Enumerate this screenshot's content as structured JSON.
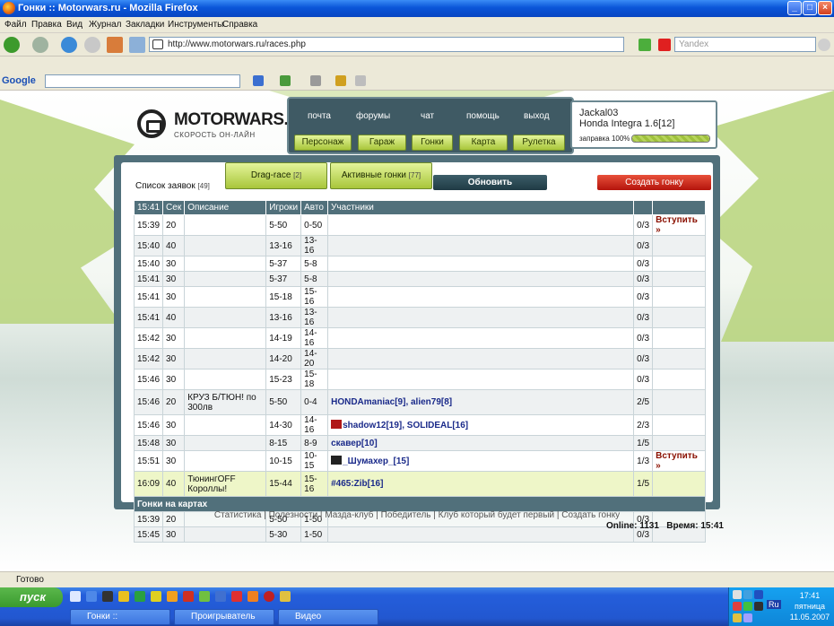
{
  "window": {
    "title": "Гонки :: Motorwars.ru - Mozilla Firefox",
    "min": "_",
    "max": "□",
    "close": "×"
  },
  "menu": [
    "Файл",
    "Правка",
    "Вид",
    "Журнал",
    "Закладки",
    "Инструменты",
    "Справка"
  ],
  "nav": {
    "url": "http://www.motorwars.ru/races.php",
    "search_placeholder": "Yandex"
  },
  "google": {
    "label": "Google"
  },
  "site": {
    "logo": "MOTORWARS.RU",
    "tagline": "СКОРОСТЬ ОН-ЛАЙН",
    "top_links": [
      "почта",
      "форумы",
      "чат",
      "помощь",
      "выход"
    ],
    "buttons": [
      "Персонаж",
      "Гараж",
      "Гонки",
      "Карта",
      "Рулетка"
    ],
    "user": {
      "name": "Jackal03",
      "car": "Honda Integra 1.6[12]",
      "fuel_label": "заправка 100%",
      "fuel_percent": 100
    }
  },
  "races": {
    "list_title": "Список заявок",
    "list_count": "[49]",
    "tab_drag": "Drag-race",
    "tab_drag_count": "[2]",
    "tab_active": "Активные гонки",
    "tab_active_count": "[77]",
    "refresh": "Обновить",
    "create": "Создать гонку",
    "headers": [
      "15:41",
      "Сек",
      "Описание",
      "Игроки",
      "Авто",
      "Участники",
      "",
      ""
    ],
    "rows": [
      {
        "time": "15:39",
        "sec": "20",
        "desc": "",
        "players": "5-50",
        "auto": "0-50",
        "parts": "",
        "count": "0/3",
        "join": "Вступить »"
      },
      {
        "time": "15:40",
        "sec": "40",
        "desc": "",
        "players": "13-16",
        "auto": "13-16",
        "parts": "",
        "count": "0/3",
        "join": ""
      },
      {
        "time": "15:40",
        "sec": "30",
        "desc": "",
        "players": "5-37",
        "auto": "5-8",
        "parts": "",
        "count": "0/3",
        "join": ""
      },
      {
        "time": "15:41",
        "sec": "30",
        "desc": "",
        "players": "5-37",
        "auto": "5-8",
        "parts": "",
        "count": "0/3",
        "join": ""
      },
      {
        "time": "15:41",
        "sec": "30",
        "desc": "",
        "players": "15-18",
        "auto": "15-16",
        "parts": "",
        "count": "0/3",
        "join": ""
      },
      {
        "time": "15:41",
        "sec": "40",
        "desc": "",
        "players": "13-16",
        "auto": "13-16",
        "parts": "",
        "count": "0/3",
        "join": ""
      },
      {
        "time": "15:42",
        "sec": "30",
        "desc": "",
        "players": "14-19",
        "auto": "14-16",
        "parts": "",
        "count": "0/3",
        "join": ""
      },
      {
        "time": "15:42",
        "sec": "30",
        "desc": "",
        "players": "14-20",
        "auto": "14-20",
        "parts": "",
        "count": "0/3",
        "join": ""
      },
      {
        "time": "15:46",
        "sec": "30",
        "desc": "",
        "players": "15-23",
        "auto": "15-18",
        "parts": "",
        "count": "0/3",
        "join": ""
      },
      {
        "time": "15:46",
        "sec": "20",
        "desc": "КРУЗ Б/ТЮН! по 300лв",
        "players": "5-50",
        "auto": "0-4",
        "parts": "HONDAmaniac[9], alien79[8]",
        "count": "2/5",
        "join": ""
      },
      {
        "time": "15:46",
        "sec": "30",
        "desc": "",
        "players": "14-30",
        "auto": "14-16",
        "parts": "shadow12[19], SOLIDEAL[16]",
        "count": "2/3",
        "join": ""
      },
      {
        "time": "15:48",
        "sec": "30",
        "desc": "",
        "players": "8-15",
        "auto": "8-9",
        "parts": "скавер[10]",
        "count": "1/5",
        "join": ""
      },
      {
        "time": "15:51",
        "sec": "30",
        "desc": "",
        "players": "10-15",
        "auto": "10-15",
        "parts": "_Шумахер_[15]",
        "count": "1/3",
        "join": "Вступить »"
      },
      {
        "time": "16:09",
        "sec": "40",
        "desc": "ТюнингOFF Короллы!",
        "players": "15-44",
        "auto": "15-16",
        "parts": "#465:Zib[16]",
        "count": "1/5",
        "join": ""
      }
    ],
    "map_section": "Гонки на картах",
    "map_rows": [
      {
        "time": "15:39",
        "sec": "20",
        "desc": "",
        "players": "5-50",
        "auto": "1-50",
        "parts": "",
        "count": "0/3",
        "join": ""
      },
      {
        "time": "15:45",
        "sec": "30",
        "desc": "",
        "players": "5-30",
        "auto": "1-50",
        "parts": "",
        "count": "0/3",
        "join": ""
      }
    ]
  },
  "footer": {
    "links": [
      "Статистика",
      "Полезности",
      "Мазда-клуб",
      "Победитель",
      "Клуб который будет первый",
      "Создать гонку"
    ],
    "online": "Online: 1131",
    "time": "Время: 15:41"
  },
  "status": "Готово",
  "taskbar": {
    "start": "пуск",
    "tasks": [
      "Гонки :: Motorwars.r...",
      "Проигрыватель Win...",
      "Видео"
    ],
    "lang": "Ru",
    "clock_time": "17:41",
    "clock_day": "пятница",
    "clock_date": "11.05.2007"
  },
  "colors": {
    "accent": "#51707b",
    "green": "#a8c63a",
    "red": "#b4140c",
    "join": "#8a1000"
  }
}
